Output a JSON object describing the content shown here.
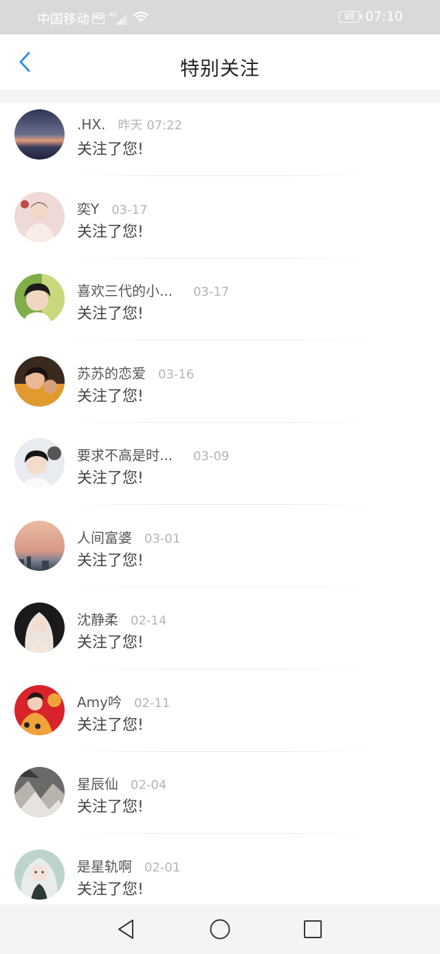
{
  "status_bar": {
    "carrier": "中国移动",
    "hd": "HD",
    "network": "4G",
    "battery": "98",
    "time": "07:10"
  },
  "header": {
    "title": "特别关注",
    "back_icon": "chevron-left-icon"
  },
  "colors": {
    "accent": "#2e8ef0",
    "status_bar_bg": "#d9d9d9",
    "name_text": "#555555",
    "time_text": "#b5b5b5",
    "message_text": "#444444"
  },
  "notifications": [
    {
      "name": ".HX.",
      "time": "昨天 07:22",
      "message": "关注了您!"
    },
    {
      "name": "奕Y",
      "time": "03-17",
      "message": "关注了您!"
    },
    {
      "name": "喜欢三代的小...",
      "time": "03-17",
      "message": "关注了您!"
    },
    {
      "name": "苏苏的恋爱",
      "time": "03-16",
      "message": "关注了您!"
    },
    {
      "name": "要求不高是时...",
      "time": "03-09",
      "message": "关注了您!"
    },
    {
      "name": "人间富婆",
      "time": "03-01",
      "message": "关注了您!"
    },
    {
      "name": "沈静柔",
      "time": "02-14",
      "message": "关注了您!"
    },
    {
      "name": "Amy吟",
      "time": "02-11",
      "message": "关注了您!"
    },
    {
      "name": "星辰仙",
      "time": "02-04",
      "message": "关注了您!"
    },
    {
      "name": "是星轨啊",
      "time": "02-01",
      "message": "关注了您!"
    }
  ],
  "nav_bar": {
    "back": "triangle-back-icon",
    "home": "circle-home-icon",
    "recents": "square-recents-icon"
  }
}
